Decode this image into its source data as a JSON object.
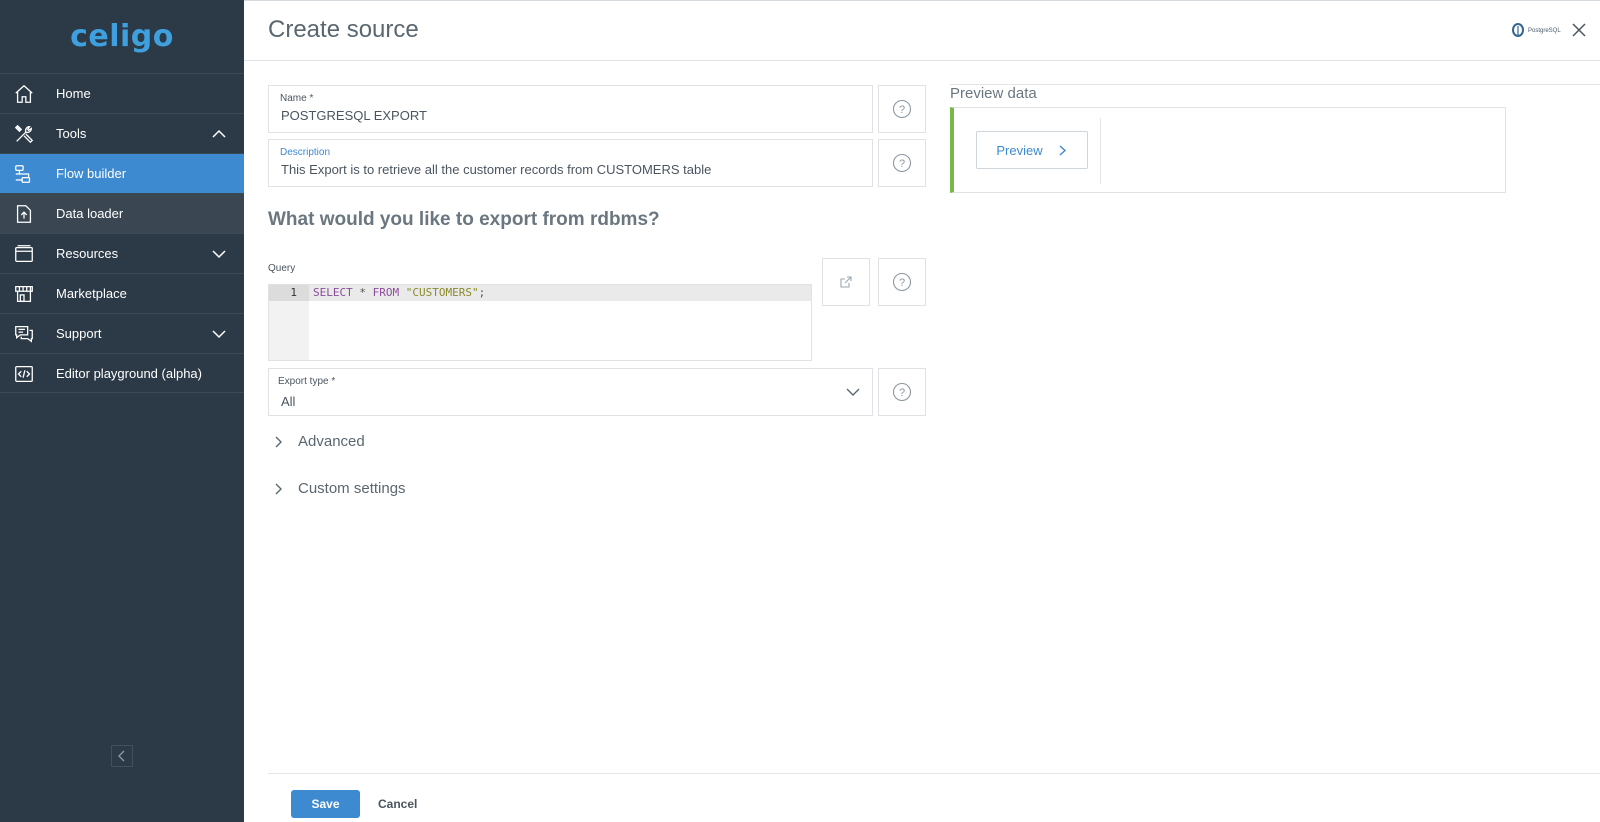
{
  "brand": {
    "logo_text": "celigo"
  },
  "sidebar": {
    "items": [
      {
        "label": "Home",
        "icon": "home-icon"
      },
      {
        "label": "Tools",
        "icon": "tools-icon",
        "expanded": true
      },
      {
        "label": "Flow builder",
        "icon": "flow-builder-icon",
        "active": true
      },
      {
        "label": "Data loader",
        "icon": "data-loader-icon"
      },
      {
        "label": "Resources",
        "icon": "resources-icon",
        "expanded": false
      },
      {
        "label": "Marketplace",
        "icon": "marketplace-icon"
      },
      {
        "label": "Support",
        "icon": "support-icon",
        "expanded": false
      },
      {
        "label": "Editor playground (alpha)",
        "icon": "editor-playground-icon"
      }
    ]
  },
  "header": {
    "title": "Create source",
    "connector_logo_text": "PostgreSQL"
  },
  "form": {
    "name": {
      "label": "Name *",
      "value": "POSTGRESQL EXPORT"
    },
    "description": {
      "label": "Description",
      "value": "This Export is to retrieve all the customer records from CUSTOMERS table"
    },
    "section_question": "What would you like to export from rdbms?",
    "query": {
      "label": "Query",
      "line_number": "1",
      "tokens": {
        "select": "SELECT",
        "star": " * ",
        "from": "FROM",
        "space": " ",
        "table": "\"CUSTOMERS\"",
        "semicolon": ";"
      }
    },
    "export_type": {
      "label": "Export type *",
      "value": "All"
    },
    "advanced_label": "Advanced",
    "custom_settings_label": "Custom settings"
  },
  "preview": {
    "title": "Preview data",
    "button_label": "Preview"
  },
  "footer": {
    "save_label": "Save",
    "cancel_label": "Cancel"
  },
  "colors": {
    "sidebar_bg": "#2c3a47",
    "accent": "#3d8ad1",
    "preview_bar": "#7ab648"
  }
}
